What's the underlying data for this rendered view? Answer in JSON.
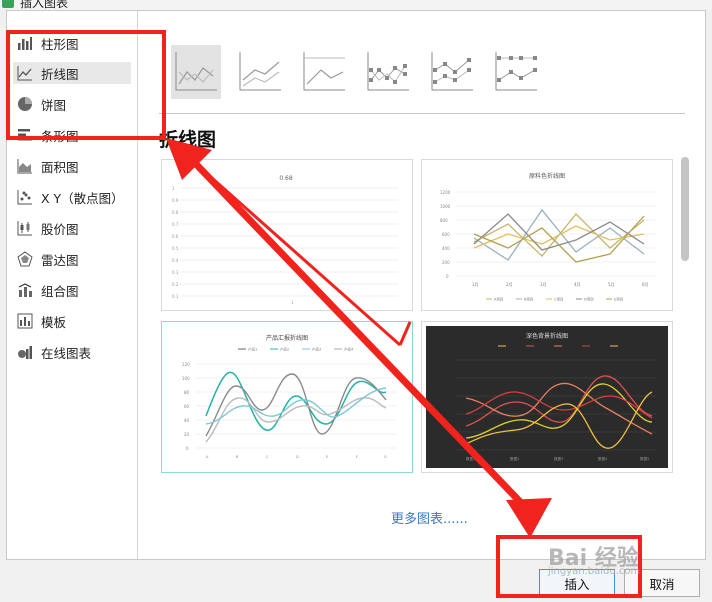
{
  "window": {
    "title": "插入图表"
  },
  "sidebar": {
    "items": [
      {
        "label": "柱形图",
        "icon": "column-chart-icon"
      },
      {
        "label": "折线图",
        "icon": "line-chart-icon",
        "active": true
      },
      {
        "label": "饼图",
        "icon": "pie-chart-icon"
      },
      {
        "label": "条形图",
        "icon": "bar-chart-icon"
      },
      {
        "label": "面积图",
        "icon": "area-chart-icon"
      },
      {
        "label": "X Y（散点图）",
        "icon": "scatter-chart-icon"
      },
      {
        "label": "股价图",
        "icon": "stock-chart-icon"
      },
      {
        "label": "雷达图",
        "icon": "radar-chart-icon"
      },
      {
        "label": "组合图",
        "icon": "combo-chart-icon"
      },
      {
        "label": "模板",
        "icon": "template-icon"
      },
      {
        "label": "在线图表",
        "icon": "online-chart-icon"
      }
    ]
  },
  "main": {
    "section_title": "折线图",
    "more_link": "更多图表......",
    "cards": [
      {
        "title": "0.68"
      },
      {
        "title": "原料色折线图",
        "legend": [
          "A项目",
          "B项目",
          "C项目",
          "D项目",
          "E项目"
        ],
        "x": [
          "1月",
          "2月",
          "3月",
          "4月",
          "5月",
          "6月"
        ],
        "y_ticks": [
          "1200",
          "1000",
          "800",
          "600",
          "400",
          "200",
          "0"
        ]
      },
      {
        "title": "产品汇报折线图",
        "legend": [
          "产品1",
          "产品2",
          "产品3",
          "产品4"
        ],
        "y_ticks": [
          "120",
          "100",
          "80",
          "60",
          "40",
          "20",
          "0"
        ]
      },
      {
        "title": "深色背景折线图"
      }
    ]
  },
  "footer": {
    "insert_label": "插入",
    "cancel_label": "取消"
  },
  "colors": {
    "annotation": "#f0231d",
    "accent": "#4a90d9",
    "link": "#3c78c8"
  },
  "watermark": {
    "text": "Bai 经验",
    "sub": "jingyan.baidu.com"
  }
}
